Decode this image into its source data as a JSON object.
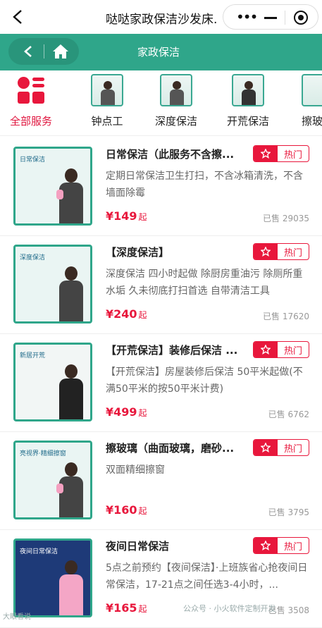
{
  "window": {
    "title": "哒哒家政保洁沙发床..."
  },
  "navbar": {
    "title": "家政保洁"
  },
  "categories": [
    {
      "label": "全部服务"
    },
    {
      "label": "钟点工"
    },
    {
      "label": "深度保洁"
    },
    {
      "label": "开荒保洁"
    },
    {
      "label": "擦玻"
    }
  ],
  "items": [
    {
      "name": "日常保洁（此服务不含擦...",
      "badge": "热门",
      "desc": "定期日常保洁卫生打扫，不含冰箱清洗，不含墙面除霉",
      "currency": "¥",
      "price": "149",
      "suffix": "起",
      "sold": "已售 29035",
      "img_text": "日常保洁"
    },
    {
      "name": "【深度保洁】",
      "badge": "热门",
      "desc": "深度保洁 四小时起做 除厨房重油污 除厕所重水垢 久未彻底打扫首选 自带清洁工具",
      "currency": "¥",
      "price": "240",
      "suffix": "起",
      "sold": "已售 17620",
      "img_text": "深度保洁"
    },
    {
      "name": "【开荒保洁】装修后保洁 ...",
      "badge": "热门",
      "desc": "【开荒保洁】房屋装修后保洁 50平米起做(不满50平米的按50平米计费)",
      "currency": "¥",
      "price": "499",
      "suffix": "起",
      "sold": "已售 6762",
      "img_text": "新居开荒"
    },
    {
      "name": "擦玻璃（曲面玻璃，磨砂...",
      "badge": "热门",
      "desc": "双面精细擦窗",
      "currency": "¥",
      "price": "160",
      "suffix": "起",
      "sold": "已售 3795",
      "img_text": "亮视界·精细擦窗"
    },
    {
      "name": "夜间日常保洁",
      "badge": "热门",
      "desc": "5点之前预约【夜间保洁】·上班族省心抢夜间日常保洁，17-21点之间任选3-4小时，...",
      "currency": "¥",
      "price": "165",
      "suffix": "起",
      "sold": "已售 3508",
      "img_text": "夜间日常保洁"
    }
  ],
  "watermark": {
    "text": "公众号 · 小火软件定制开发",
    "corner": "大眼看说"
  },
  "colors": {
    "accent": "#2fa68a",
    "hot": "#e8173c"
  },
  "icons": [
    "back-icon",
    "more-icon",
    "minimize-icon",
    "close-record-icon",
    "chevron-left-icon",
    "home-icon",
    "grid-icon",
    "star-icon"
  ]
}
